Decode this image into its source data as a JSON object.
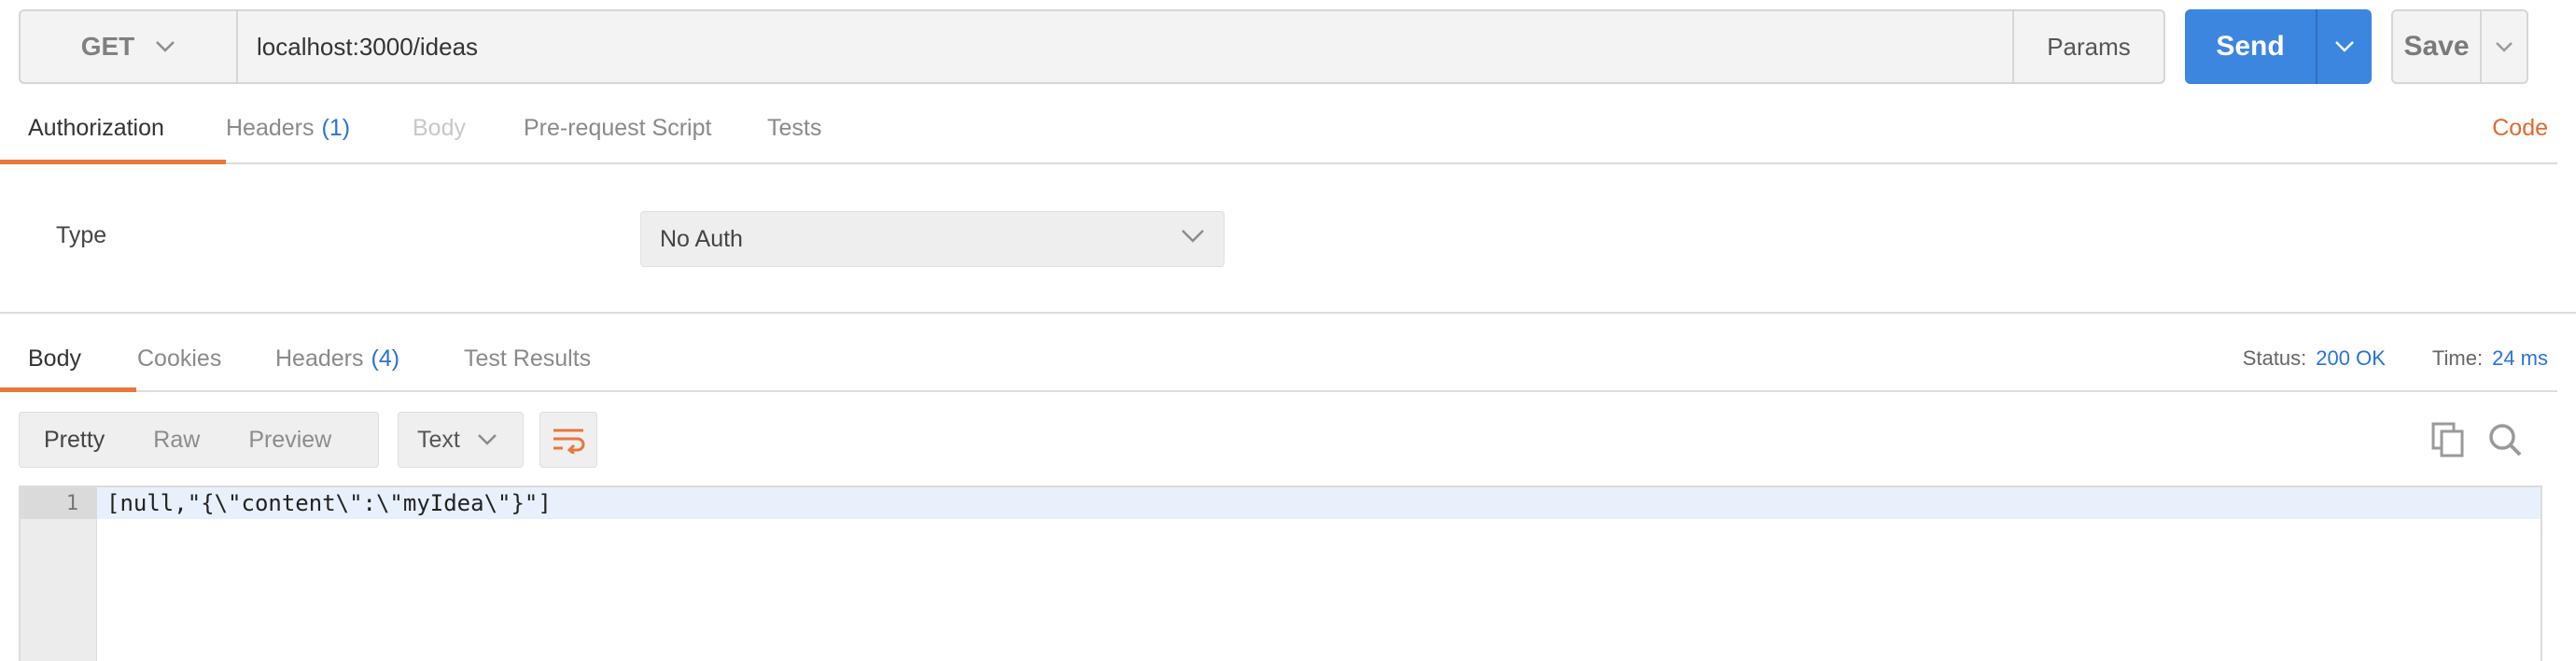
{
  "request": {
    "method": "GET",
    "url": "localhost:3000/ideas",
    "params_label": "Params",
    "send_label": "Send",
    "save_label": "Save"
  },
  "request_tabs": [
    {
      "label": "Authorization",
      "active": true
    },
    {
      "label": "Headers",
      "count": "(1)"
    },
    {
      "label": "Body",
      "disabled": true
    },
    {
      "label": "Pre-request Script"
    },
    {
      "label": "Tests"
    }
  ],
  "code_link": "Code",
  "auth": {
    "type_label": "Type",
    "selected": "No Auth"
  },
  "response_tabs": [
    {
      "label": "Body",
      "active": true
    },
    {
      "label": "Cookies"
    },
    {
      "label": "Headers",
      "count": "(4)"
    },
    {
      "label": "Test Results"
    }
  ],
  "response_meta": {
    "status_label": "Status:",
    "status_value": "200 OK",
    "time_label": "Time:",
    "time_value": "24 ms"
  },
  "response_view": {
    "modes": [
      "Pretty",
      "Raw",
      "Preview"
    ],
    "format": "Text"
  },
  "response_body": {
    "line_number": "1",
    "line": "[null,\"{\\\"content\\\":\\\"myIdea\\\"}\"]"
  },
  "colors": {
    "accent": "#e8773c",
    "send": "#3c86e0",
    "link": "#2b72d6"
  },
  "icons": [
    "chevron-down-icon",
    "wrap-lines-icon",
    "copy-icon",
    "search-icon"
  ]
}
